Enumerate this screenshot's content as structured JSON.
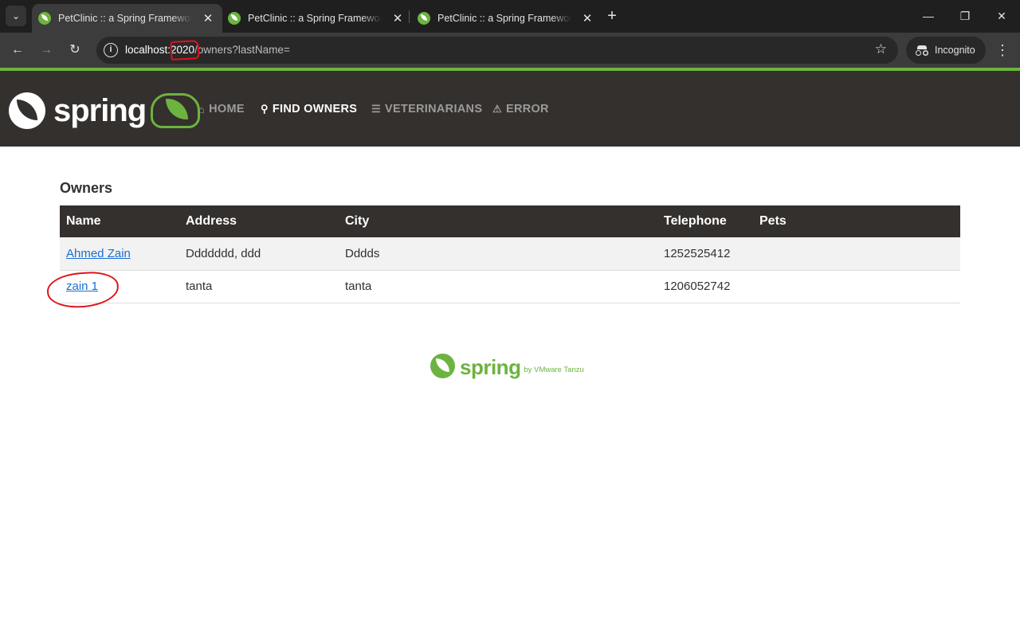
{
  "browser": {
    "tabs": [
      {
        "title": "PetClinic :: a Spring Framework demonstration",
        "active": true
      },
      {
        "title": "PetClinic :: a Spring Framework demonstration",
        "active": false
      },
      {
        "title": "PetClinic :: a Spring Framework demonstration",
        "active": false
      }
    ],
    "url": {
      "host": "localhost:2020",
      "path": "/owners?lastName="
    },
    "incognito_label": "Incognito"
  },
  "navbar": {
    "brand_text": "spring",
    "items": [
      {
        "label": "HOME",
        "icon": "home-icon"
      },
      {
        "label": "FIND OWNERS",
        "icon": "search-icon",
        "active": true
      },
      {
        "label": "VETERINARIANS",
        "icon": "list-icon"
      },
      {
        "label": "ERROR",
        "icon": "warning-icon"
      }
    ]
  },
  "main": {
    "title": "Owners",
    "table": {
      "columns": [
        "Name",
        "Address",
        "City",
        "Telephone",
        "Pets"
      ],
      "rows": [
        {
          "name": "Ahmed Zain",
          "address": "Ddddddd, ddd",
          "city": "Dddds",
          "telephone": "1252525412",
          "pets": ""
        },
        {
          "name": "zain 1",
          "address": "tanta",
          "city": "tanta",
          "telephone": "1206052742",
          "pets": ""
        }
      ]
    }
  },
  "footer": {
    "brand_text": "spring",
    "by_text": "by VMware Tanzu"
  },
  "colors": {
    "spring_green": "#6db33f",
    "navbar_bg": "#34302d",
    "annotation_red": "#e0131b"
  }
}
